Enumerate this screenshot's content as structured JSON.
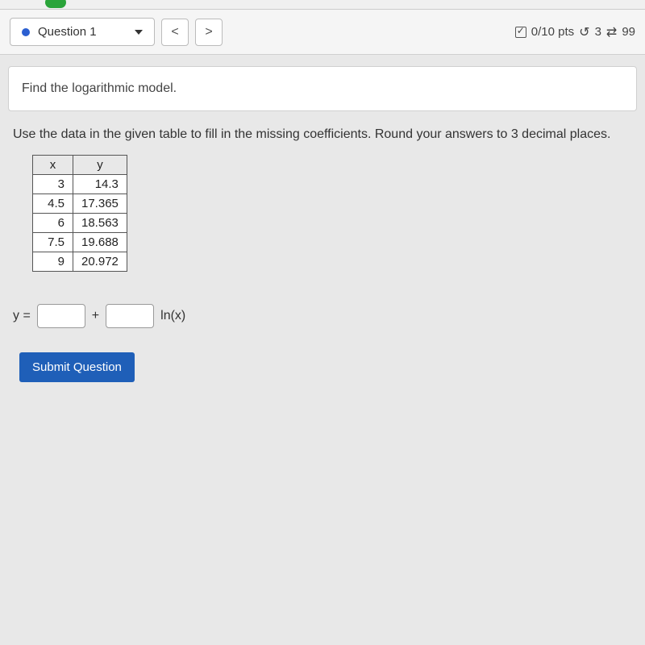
{
  "nav": {
    "question_label": "Question 1",
    "prev_symbol": "<",
    "next_symbol": ">",
    "score_text": "0/10 pts",
    "attempts_text": "3",
    "retries_text": "99"
  },
  "prompt": {
    "text": "Find the logarithmic model."
  },
  "instruction": {
    "text": "Use the data in the given table to fill in the missing coefficients. Round your answers to 3 decimal places."
  },
  "chart_data": {
    "type": "table",
    "columns": [
      "x",
      "y"
    ],
    "rows": [
      {
        "x": "3",
        "y": "14.3"
      },
      {
        "x": "4.5",
        "y": "17.365"
      },
      {
        "x": "6",
        "y": "18.563"
      },
      {
        "x": "7.5",
        "y": "19.688"
      },
      {
        "x": "9",
        "y": "20.972"
      }
    ]
  },
  "equation": {
    "lhs": "y =",
    "plus": "+",
    "tail": "ln(x)"
  },
  "submit": {
    "label": "Submit Question"
  }
}
